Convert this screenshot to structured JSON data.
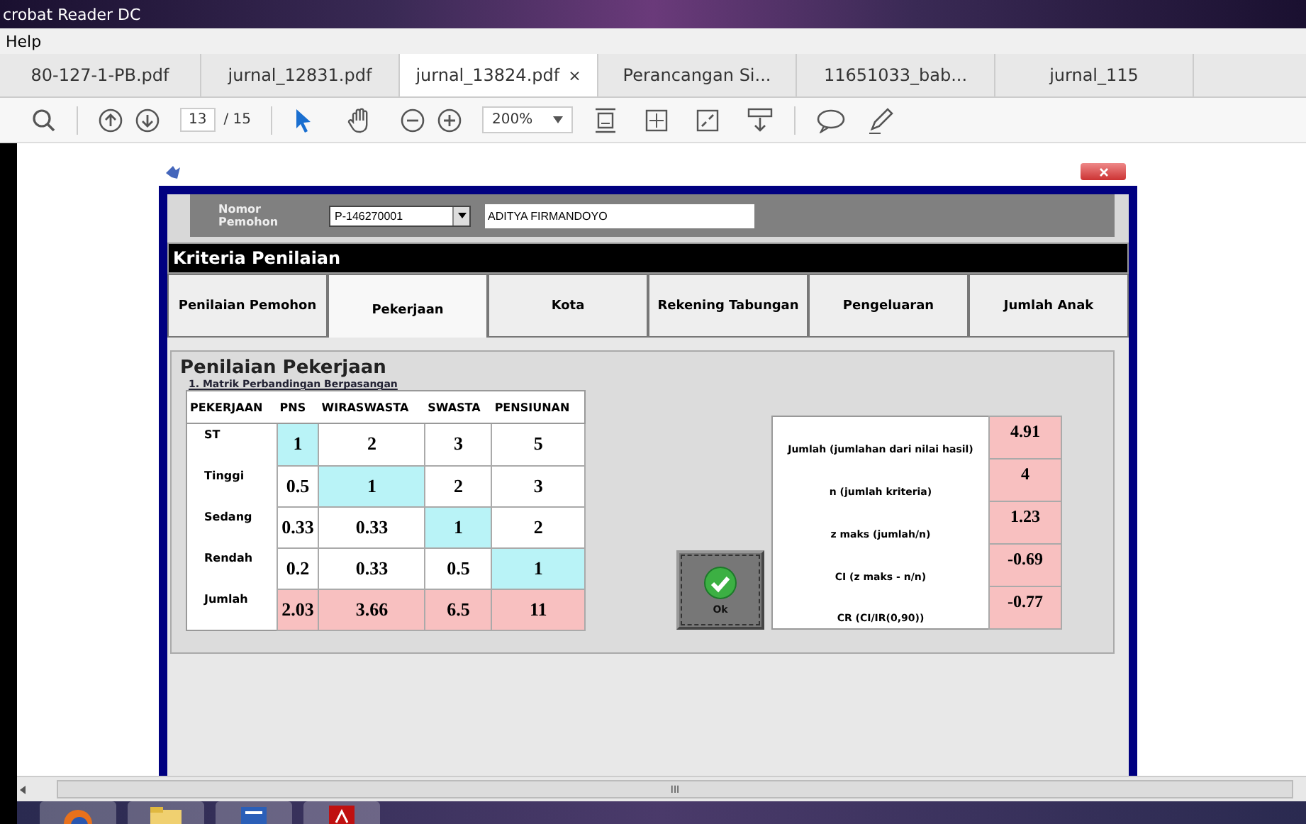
{
  "window": {
    "title": "crobat Reader DC"
  },
  "menu": [
    "Help"
  ],
  "doc_tabs": [
    {
      "label": "80-127-1-PB.pdf",
      "selected": false
    },
    {
      "label": "jurnal_12831.pdf",
      "selected": false
    },
    {
      "label": "jurnal_13824.pdf",
      "selected": true,
      "close": "×"
    },
    {
      "label": "Perancangan Si...",
      "selected": false
    },
    {
      "label": "11651033_bab...",
      "selected": false
    },
    {
      "label": "jurnal_115",
      "selected": false
    }
  ],
  "toolbar": {
    "page": "13",
    "page_total": "/ 15",
    "zoom": "200%"
  },
  "form": {
    "applicant_label": "Nomor Pemohon",
    "applicant_id": "P-146270001",
    "applicant_name": "ADITYA FIRMANDOYO",
    "section_title": "Kriteria Penilaian",
    "tabs": [
      {
        "label": "Penilaian Pemohon",
        "selected": false
      },
      {
        "label": "Pekerjaan",
        "selected": true
      },
      {
        "label": "Kota",
        "selected": false
      },
      {
        "label": "Rekening Tabungan",
        "selected": false
      },
      {
        "label": "Pengeluaran",
        "selected": false
      },
      {
        "label": "Jumlah Anak",
        "selected": false
      }
    ],
    "group_title": "Penilaian Pekerjaan",
    "matrix_title": "1. Matrik Perbandingan Berpasangan",
    "matrix": {
      "columns": [
        "PEKERJAAN",
        "PNS",
        "WIRASWASTA",
        "SWASTA",
        "PENSIUNAN"
      ],
      "rows": [
        {
          "kind": "pair",
          "cells": [
            {
              "value": "ST"
            },
            {
              "value": "1",
              "highlighted": true
            },
            {
              "value": "2",
              "highlighted": false
            },
            {
              "value": "3",
              "highlighted": false
            },
            {
              "value": "5",
              "highlighted": false
            }
          ]
        },
        {
          "kind": "pair",
          "cells": [
            {
              "value": "Tinggi"
            },
            {
              "value": "0.5",
              "highlighted": false
            },
            {
              "value": "1",
              "highlighted": true
            },
            {
              "value": "2",
              "highlighted": false
            },
            {
              "value": "3",
              "highlighted": false
            }
          ]
        },
        {
          "kind": "pair",
          "cells": [
            {
              "value": "Sedang"
            },
            {
              "value": "0.33",
              "highlighted": false
            },
            {
              "value": "0.33",
              "highlighted": false
            },
            {
              "value": "1",
              "highlighted": true
            },
            {
              "value": "2",
              "highlighted": false
            }
          ]
        },
        {
          "kind": "pair",
          "cells": [
            {
              "value": "Rendah"
            },
            {
              "value": "0.2",
              "highlighted": false
            },
            {
              "value": "0.33",
              "highlighted": false
            },
            {
              "value": "0.5",
              "highlighted": false
            },
            {
              "value": "1",
              "highlighted": true
            }
          ]
        },
        {
          "kind": "total",
          "cells": [
            {
              "value": "Jumlah"
            },
            {
              "value": "2.03"
            },
            {
              "value": "3.66"
            },
            {
              "value": "6.5"
            },
            {
              "value": "11"
            }
          ]
        }
      ]
    },
    "results": [
      {
        "label": "Jumlah (jumlahan dari nilai hasil)",
        "value": "4.91"
      },
      {
        "label": "n (jumlah kriteria)",
        "value": "4"
      },
      {
        "label": "z maks (jumlah/n)",
        "value": "1.23"
      },
      {
        "label": "CI (z maks - n/n)",
        "value": "-0.69"
      },
      {
        "label": "CR (CI/IR(0,90))",
        "value": "-0.77"
      }
    ],
    "ok_button": "Ok"
  },
  "scrollbar": {
    "grip": "III"
  }
}
